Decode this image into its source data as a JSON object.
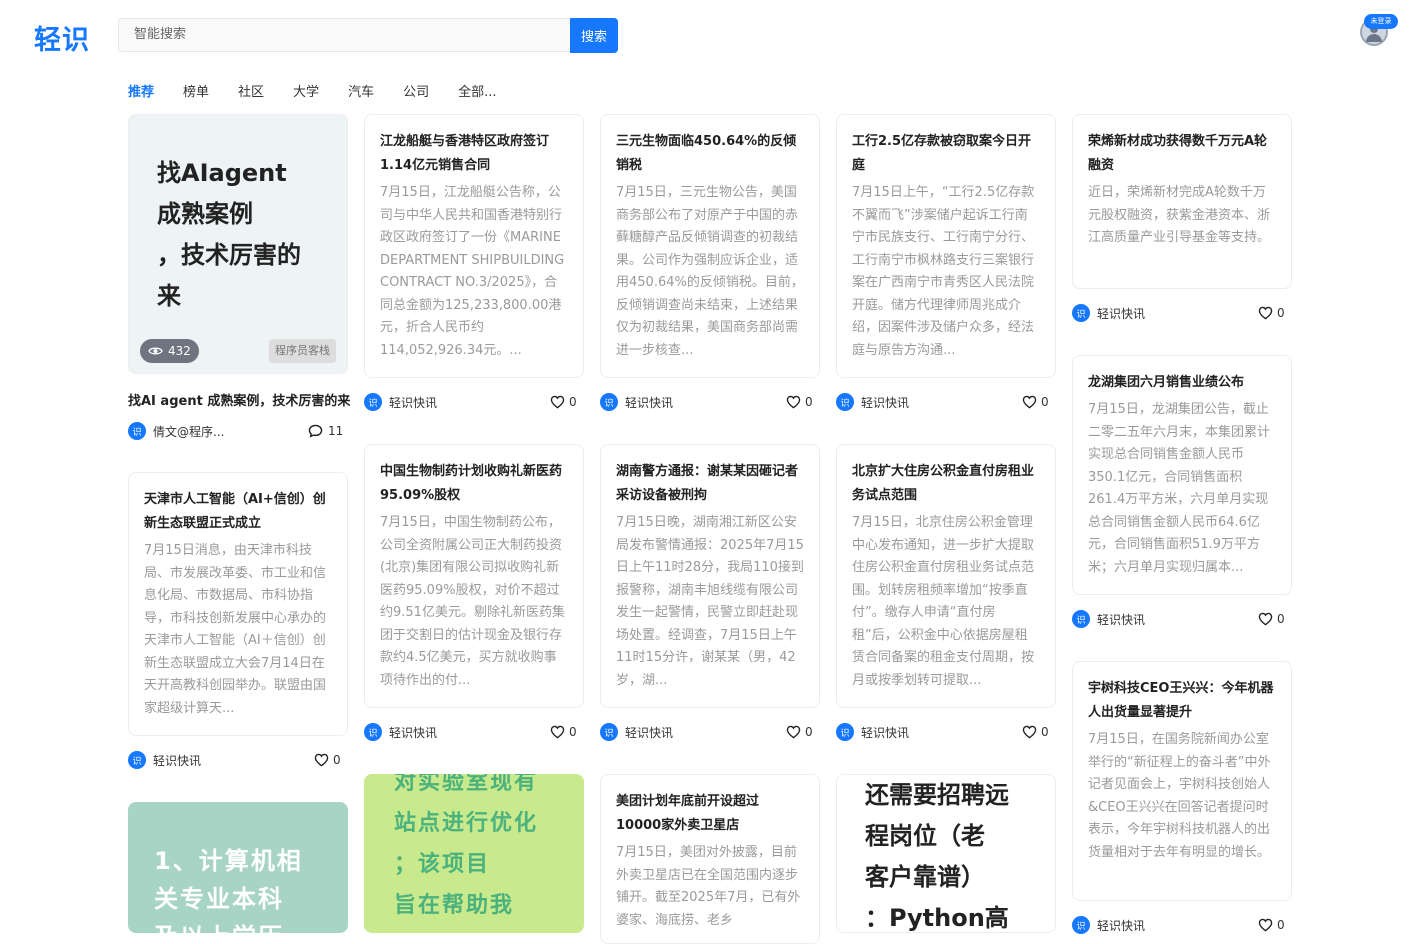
{
  "app": {
    "logo": "轻识",
    "search_placeholder": "智能搜索",
    "search_button": "搜索",
    "login_badge": "未登录"
  },
  "nav": [
    "推荐",
    "榜单",
    "社区",
    "大学",
    "汽车",
    "公司",
    "全部..."
  ],
  "featured": {
    "image_text": [
      "找AIagent",
      "成熟案例",
      "，技术厉害的",
      "来"
    ],
    "views": "432",
    "source": "程序员客栈",
    "caption": "找AI agent 成熟案例，技术厉害的来",
    "author": "倩文@程序...",
    "comments": "11"
  },
  "cards": [
    {
      "title": "天津市人工智能（AI+信创）创新生态联盟正式成立",
      "body": "7月15日消息，由天津市科技局、市发展改革委、市工业和信息化局、市数据局、市科协指导，市科技创新发展中心承办的天津市人工智能（AI＋信创）创新生态联盟成立大会7月14日在天开高教科创园举办。联盟由国家超级计算天...",
      "author": "轻识快讯",
      "likes": "0"
    },
    {
      "title": "江龙船艇与香港特区政府签订1.14亿元销售合同",
      "body": "7月15日，江龙船艇公告称，公司与中华人民共和国香港特别行政区政府签订了一份《MARINE DEPARTMENT SHIPBUILDING CONTRACT NO.3/2025》，合同总金额为125,233,800.00港元，折合人民币约114,052,926.34元。...",
      "author": "轻识快讯",
      "likes": "0"
    },
    {
      "title": "三元生物面临450.64%的反倾销税",
      "body": "7月15日，三元生物公告，美国商务部公布了对原产于中国的赤藓糖醇产品反倾销调查的初裁结果。公司作为强制应诉企业，适用450.64%的反倾销税。目前，反倾销调查尚未结束，上述结果仅为初裁结果，美国商务部尚需进一步核查...",
      "author": "轻识快讯",
      "likes": "0"
    },
    {
      "title": "工行2.5亿存款被窃取案今日开庭",
      "body": "7月15日上午，“工行2.5亿存款不翼而飞”涉案储户起诉工行南宁市民族支行、工行南宁分行、工行南宁市枫林路支行三案银行案在广西南宁市青秀区人民法院开庭。储方代理律师周兆成介绍，因案件涉及储户众多，经法庭与原告方沟通...",
      "author": "轻识快讯",
      "likes": "0"
    },
    {
      "title": "荣烯新材成功获得数千万元A轮融资",
      "body": "近日，荣烯新材完成A轮数千万元股权融资，获紫金港资本、浙江高质量产业引导基金等支持。",
      "author": "轻识快讯",
      "likes": "0"
    },
    {
      "title": "中国生物制药计划收购礼新医药95.09%股权",
      "body": "7月15日，中国生物制药公布，公司全资附属公司正大制药投资(北京)集团有限公司拟收购礼新医药95.09%股权，对价不超过约9.51亿美元。剔除礼新医药集团于交割日的估计现金及银行存款约4.5亿美元，买方就收购事项待作出的付...",
      "author": "轻识快讯",
      "likes": "0"
    },
    {
      "title": "湖南警方通报：谢某某因砸记者采访设备被刑拘",
      "body": "7月15日晚，湖南湘江新区公安局发布警情通报：2025年7月15日上午11时28分，我局110接到报警称，湖南丰旭线缆有限公司发生一起警情，民警立即赶赴现场处置。经调查，7月15日上午11时15分许，谢某某（男，42岁，湖...",
      "author": "轻识快讯",
      "likes": "0"
    },
    {
      "title": "北京扩大住房公积金直付房租业务试点范围",
      "body": "7月15日，北京住房公积金管理中心发布通知，进一步扩大提取住房公积金直付房租业务试点范围。划转房租频率增加“按季直付”。缴存人申请“直付房租”后，公积金中心依据房屋租赁合同备案的租金支付周期，按月或按季划转可提取...",
      "author": "轻识快讯",
      "likes": "0"
    },
    {
      "title": "龙湖集团六月销售业绩公布",
      "body": "7月15日，龙湖集团公告，截止二零二五年六月末，本集团累计实现总合同销售金额人民币350.1亿元，合同销售面积261.4万平方米，六月单月实现总合同销售金额人民币64.6亿元，合同销售面积51.9万平方米；六月单月实现归属本...",
      "author": "轻识快讯",
      "likes": "0"
    },
    {
      "title": "美团计划年底前开设超过10000家外卖卫星店",
      "body": "7月15日，美团对外披露，目前外卖卫星店已在全国范围内逐步铺开。截至2025年7月，已有外婆家、海底捞、老乡",
      "author": "轻识快讯",
      "likes": "0"
    },
    {
      "title": "宇树科技CEO王兴兴：今年机器人出货量显著提升",
      "body": "7月15日，在国务院新闻办公室举行的“新征程上的奋斗者”中外记者见面会上，宇树科技创始人&CEO王兴兴在回答记者提问时表示，今年宇树科技机器人的出货量相对于去年有明显的增长。",
      "author": "轻识快讯",
      "likes": "0"
    }
  ],
  "image_cards": [
    {
      "lines": [
        "1、计算机相",
        "关专业本科",
        "及以上学历"
      ]
    },
    {
      "lines": [
        "对实验室现有",
        "站点进行优化",
        "；该项目",
        "旨在帮助我"
      ]
    },
    {
      "lines": [
        "还需要招聘远",
        "程岗位（老",
        "客户靠谱）",
        "：Python高"
      ]
    }
  ]
}
